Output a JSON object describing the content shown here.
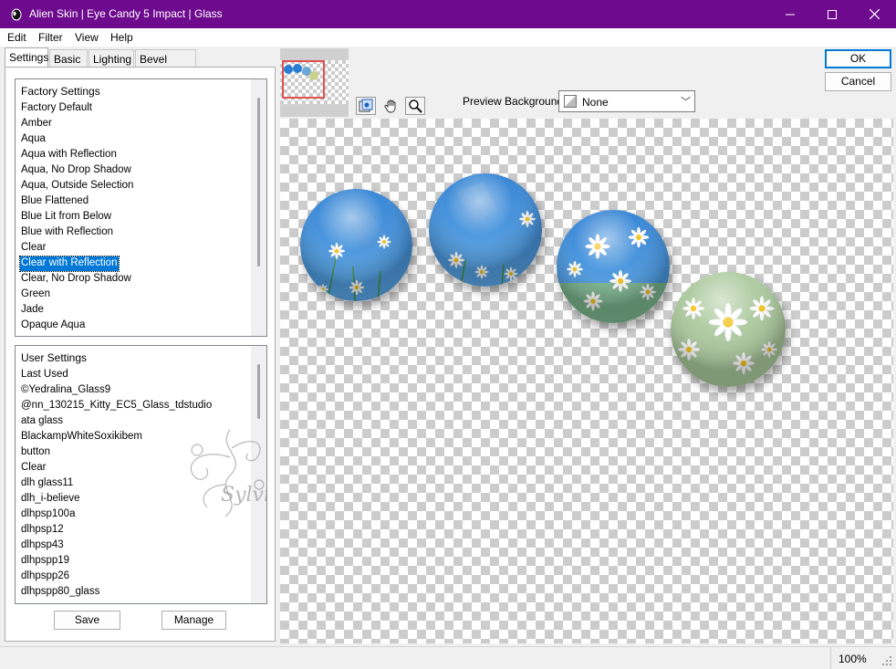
{
  "window": {
    "title": "Alien Skin | Eye Candy 5 Impact | Glass",
    "accent_color": "#6e0a8e",
    "controls": [
      "minimize-icon",
      "maximize-icon",
      "close-icon"
    ]
  },
  "menu": {
    "items": [
      "Edit",
      "Filter",
      "View",
      "Help"
    ]
  },
  "tabs": [
    "Settings",
    "Basic",
    "Lighting",
    "Bevel Profile"
  ],
  "factory_settings": {
    "header": "Factory Settings",
    "items": [
      "Factory Default",
      "Amber",
      "Aqua",
      "Aqua with Reflection",
      "Aqua, No Drop Shadow",
      "Aqua, Outside Selection",
      "Blue Flattened",
      "Blue Lit from Below",
      "Blue with Reflection",
      "Clear",
      "Clear with Reflection",
      "Clear, No Drop Shadow",
      "Green",
      "Jade",
      "Opaque Aqua"
    ],
    "selected": "Clear with Reflection"
  },
  "user_settings": {
    "header": "User Settings",
    "items": [
      "Last Used",
      "©Yedralina_Glass9",
      "@nn_130215_Kitty_EC5_Glass_tdstudio",
      "ata glass",
      "BlackampWhiteSoxikibem",
      "button",
      "Clear",
      "dlh glass11",
      "dlh_i-believe",
      "dlhpsp100a",
      "dlhpsp12",
      "dlhpsp43",
      "dlhpspp19",
      "dlhpspp26",
      "dlhpspp80_glass"
    ]
  },
  "buttons": {
    "save": "Save",
    "manage": "Manage",
    "ok": "OK",
    "cancel": "Cancel"
  },
  "preview": {
    "background_label": "Preview Background:",
    "background_value": "None",
    "tools": [
      "navigate-preview-icon",
      "hand-pan-icon",
      "zoom-magnifier-icon"
    ]
  },
  "watermark": "Sylviane",
  "status": {
    "zoom": "100%"
  }
}
